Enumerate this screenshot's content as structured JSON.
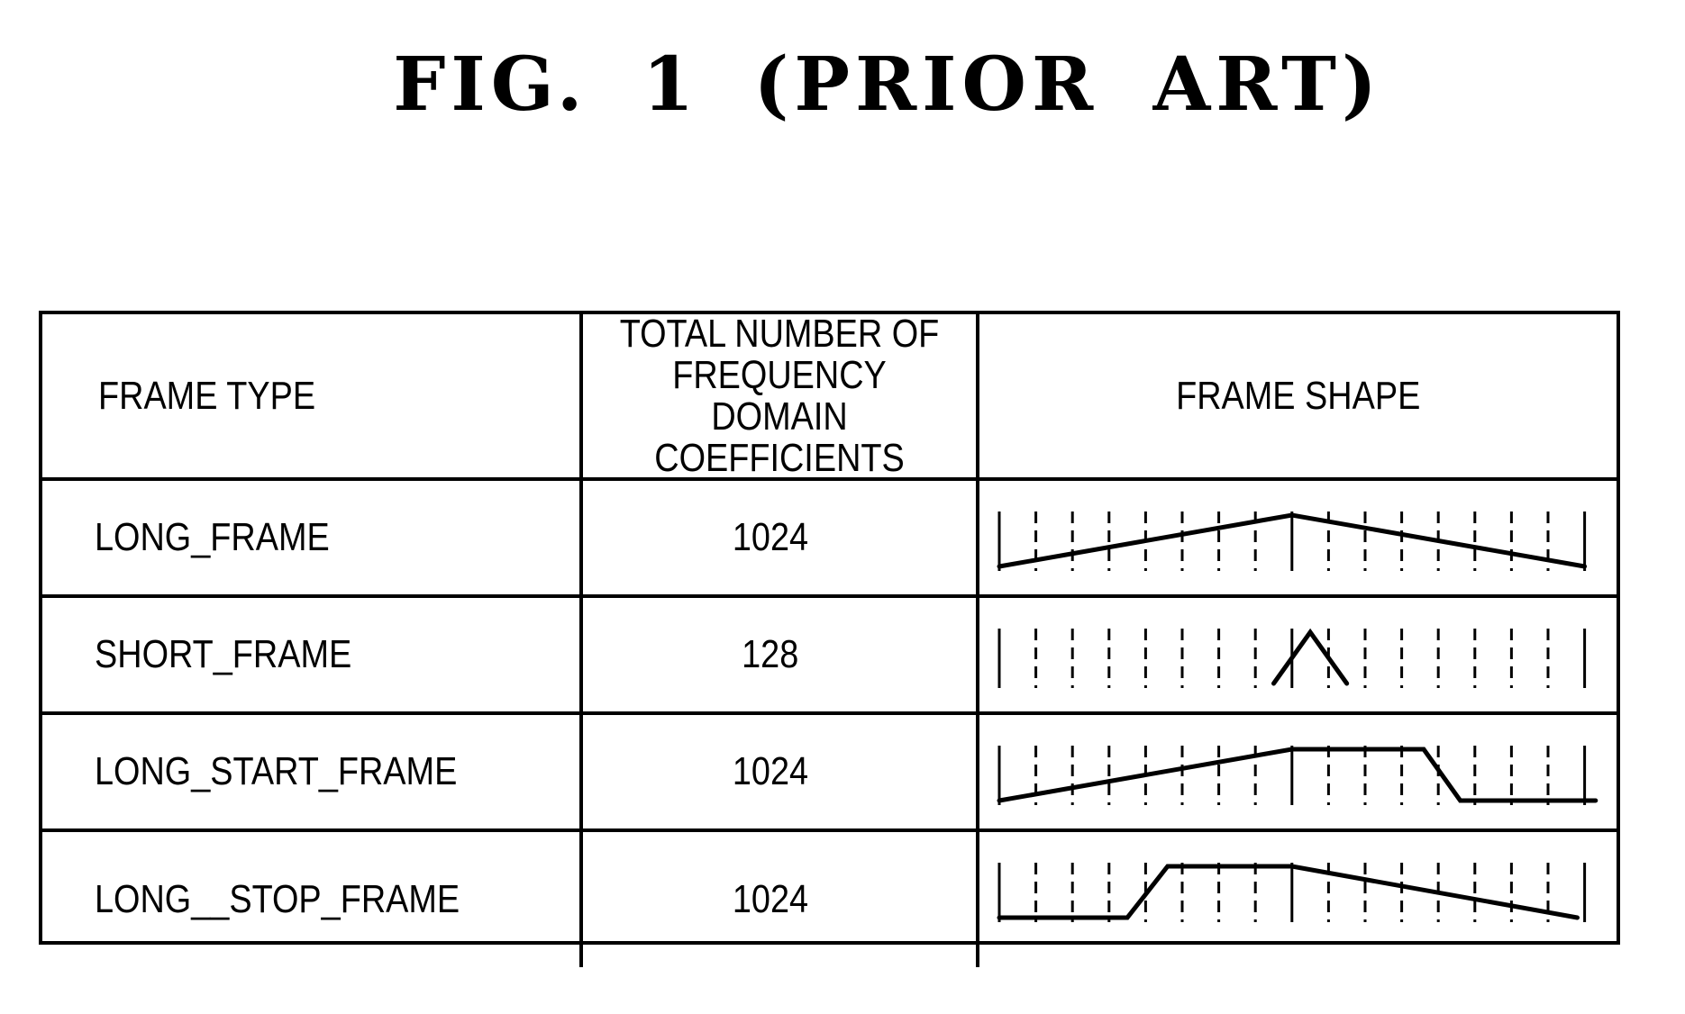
{
  "figure": {
    "title": "FIG. 1 (PRIOR ART)"
  },
  "table": {
    "headers": {
      "frame_type": "FRAME TYPE",
      "coefficients": "TOTAL NUMBER OF FREQUENCY DOMAIN COEFFICIENTS",
      "frame_shape": "FRAME SHAPE"
    },
    "grid_divisions": 16,
    "solid_divisions": [
      0,
      8,
      16
    ],
    "rows": [
      {
        "frame_type": "LONG_FRAME",
        "coefficients": "1024",
        "shape_name": "long-window",
        "shape": [
          [
            0,
            0
          ],
          [
            8,
            1
          ],
          [
            16,
            0
          ]
        ]
      },
      {
        "frame_type": "SHORT_FRAME",
        "coefficients": "128",
        "shape_name": "short-window",
        "shape": [
          [
            7.5,
            0
          ],
          [
            8.5,
            1
          ],
          [
            9.5,
            0
          ]
        ]
      },
      {
        "frame_type": "LONG_START_FRAME",
        "coefficients": "1024",
        "shape_name": "long-start-window",
        "shape": [
          [
            0,
            0
          ],
          [
            8,
            1
          ],
          [
            11.6,
            1
          ],
          [
            12.6,
            0
          ],
          [
            16.3,
            0
          ]
        ]
      },
      {
        "frame_type": "LONG__STOP_FRAME",
        "coefficients": "1024",
        "shape_name": "long-stop-window",
        "shape": [
          [
            0,
            0
          ],
          [
            3.5,
            0
          ],
          [
            4.6,
            1
          ],
          [
            8,
            1
          ],
          [
            15.8,
            0
          ]
        ]
      }
    ]
  }
}
